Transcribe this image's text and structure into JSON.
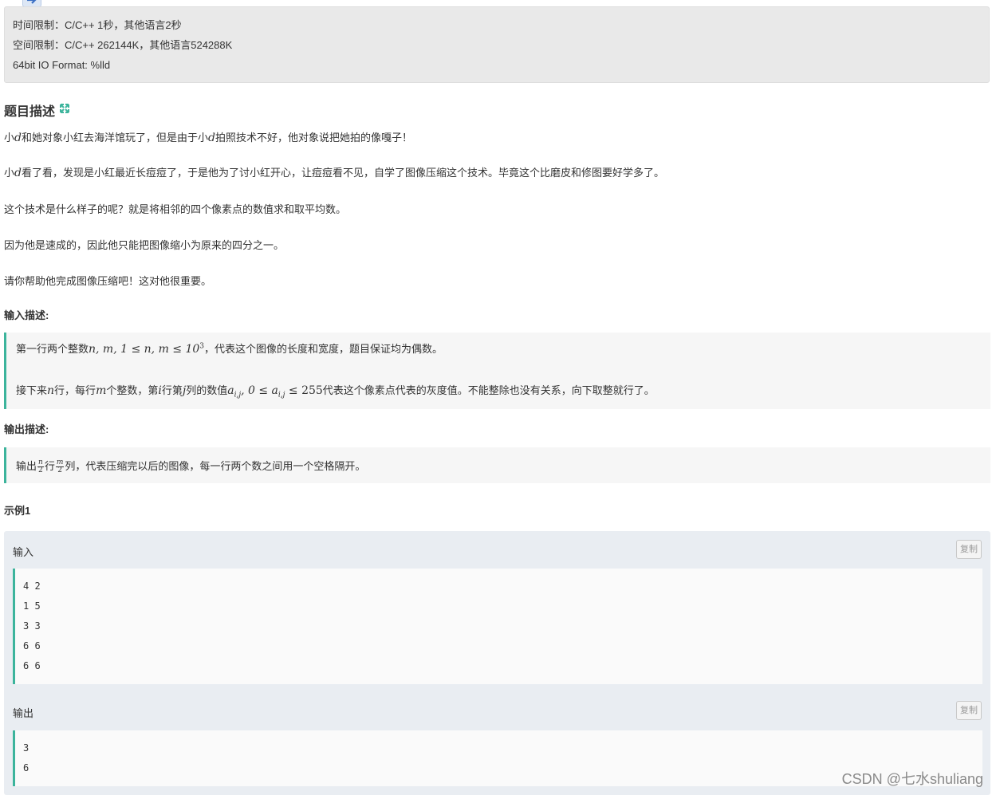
{
  "limits": {
    "time": "时间限制：C/C++ 1秒，其他语言2秒",
    "space": "空间限制：C/C++ 262144K，其他语言524288K",
    "io": "64bit IO Format: %lld"
  },
  "description": {
    "title": "题目描述",
    "p1_a": "小",
    "p1_var": "d",
    "p1_b": "和她对象小红去海洋馆玩了，但是由于小",
    "p1_var2": "d",
    "p1_c": "拍照技术不好，他对象说把她拍的像嘎子！",
    "p2_a": "小",
    "p2_var": "d",
    "p2_b": "看了看，发现是小红最近长痘痘了，于是他为了讨小红开心，让痘痘看不见，自学了图像压缩这个技术。毕竟这个比磨皮和修图要好学多了。",
    "p3": "这个技术是什么样子的呢？就是将相邻的四个像素点的数值求和取平均数。",
    "p4": "因为他是速成的，因此他只能把图像缩小为原来的四分之一。",
    "p5": "请你帮助他完成图像压缩吧！这对他很重要。"
  },
  "input_desc": {
    "title": "输入描述:",
    "l1_a": "第一行两个整数",
    "l1_math": "n, m, 1 ≤ n, m ≤ 10",
    "l1_sup": "3",
    "l1_b": "，代表这个图像的长度和宽度，题目保证均为偶数。",
    "l2_a": "接下来",
    "l2_n": "n",
    "l2_b": "行，每行",
    "l2_m": "m",
    "l2_c": "个整数，第",
    "l2_i": "i",
    "l2_d": "行第",
    "l2_j": "j",
    "l2_e": "列的数值",
    "l2_math": "a",
    "l2_sub": "i,j",
    "l2_math2": ", 0 ≤ a",
    "l2_sub2": "i,j",
    "l2_math3": " ≤ 255",
    "l2_f": "代表这个像素点代表的灰度值。不能整除也没有关系，向下取整就行了。"
  },
  "output_desc": {
    "title": "输出描述:",
    "a": "输出",
    "frac1_n": "n",
    "frac1_d": "2",
    "b": "行",
    "frac2_n": "m",
    "frac2_d": "2",
    "c": "列，代表压缩完以后的图像，每一行两个数之间用一个空格隔开。"
  },
  "example": {
    "title": "示例1",
    "input_label": "输入",
    "output_label": "输出",
    "copy_label": "复制",
    "input_lines": [
      "4 2",
      "1 5",
      "3 3",
      "6 6",
      "6 6"
    ],
    "output_lines": [
      "3",
      "6"
    ]
  },
  "watermark": "CSDN @七水shuliang",
  "colors": {
    "accent": "#3cb49c",
    "panel": "#e9e9e9",
    "sample_bg": "#e9edf2"
  }
}
